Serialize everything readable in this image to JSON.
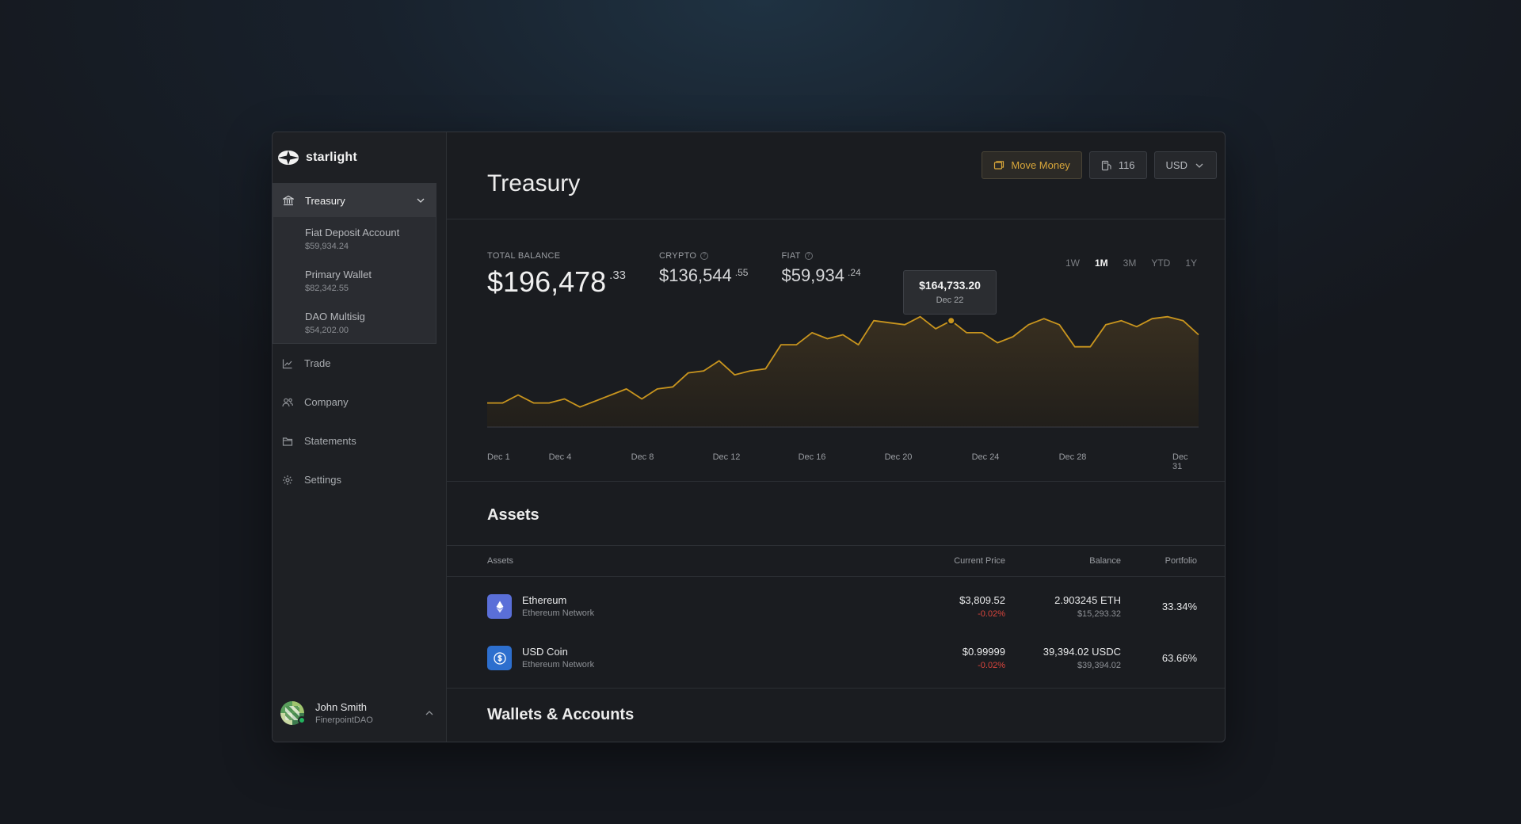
{
  "brand": {
    "name": "starlight"
  },
  "sidebar": {
    "treasury": {
      "label": "Treasury",
      "accounts": [
        {
          "name": "Fiat Deposit Account",
          "amount": "$59,934.24"
        },
        {
          "name": "Primary Wallet",
          "amount": "$82,342.55"
        },
        {
          "name": "DAO Multisig",
          "amount": "$54,202.00"
        }
      ]
    },
    "items": [
      {
        "label": "Trade",
        "icon": "chart-icon"
      },
      {
        "label": "Company",
        "icon": "users-icon"
      },
      {
        "label": "Statements",
        "icon": "folder-icon"
      },
      {
        "label": "Settings",
        "icon": "gear-icon"
      }
    ],
    "user": {
      "name": "John Smith",
      "org": "FinerpointDAO"
    }
  },
  "header": {
    "title": "Treasury",
    "move_money": "Move Money",
    "gas": "116",
    "currency": "USD"
  },
  "stats": {
    "total": {
      "label": "TOTAL BALANCE",
      "whole": "$196,478",
      "cents": ".33"
    },
    "crypto": {
      "label": "CRYPTO",
      "whole": "$136,544",
      "cents": ".55"
    },
    "fiat": {
      "label": "FIAT",
      "whole": "$59,934",
      "cents": ".24"
    }
  },
  "ranges": [
    "1W",
    "1M",
    "3M",
    "YTD",
    "1Y"
  ],
  "active_range": "1M",
  "tooltip": {
    "value": "$164,733.20",
    "date": "Dec 22"
  },
  "chart_data": {
    "type": "area",
    "x_tick_labels": [
      "Dec 1",
      "Dec 4",
      "Dec 8",
      "Dec 12",
      "Dec 16",
      "Dec 20",
      "Dec 24",
      "Dec 28",
      "Dec 31"
    ],
    "values": [
      122,
      122,
      126,
      122,
      122,
      124,
      120,
      123,
      126,
      129,
      124,
      129,
      130,
      137,
      138,
      143,
      136,
      138,
      139,
      151,
      151,
      157,
      154,
      156,
      151,
      163,
      162,
      161,
      165,
      159,
      163,
      157,
      157,
      152,
      155,
      161,
      164,
      161,
      150,
      150,
      161,
      163,
      160,
      164,
      165,
      163,
      156
    ],
    "highlight_index": 30,
    "line_color": "#c9951e",
    "fill_color": "#2a2519"
  },
  "assets": {
    "title": "Assets",
    "columns": [
      "Assets",
      "Current Price",
      "Balance",
      "Portfolio"
    ],
    "rows": [
      {
        "name": "Ethereum",
        "network": "Ethereum Network",
        "price": "$3,809.52",
        "change": "-0.02%",
        "balance": "2.903245 ETH",
        "balance_usd": "$15,293.32",
        "portfolio": "33.34%",
        "icon": "ethereum-icon",
        "color": "#5a6fd8"
      },
      {
        "name": "USD Coin",
        "network": "Ethereum Network",
        "price": "$0.99999",
        "change": "-0.02%",
        "balance": "39,394.02 USDC",
        "balance_usd": "$39,394.02",
        "portfolio": "63.66%",
        "icon": "usdc-icon",
        "color": "#2d6fce"
      }
    ]
  },
  "wallets": {
    "title": "Wallets & Accounts"
  }
}
